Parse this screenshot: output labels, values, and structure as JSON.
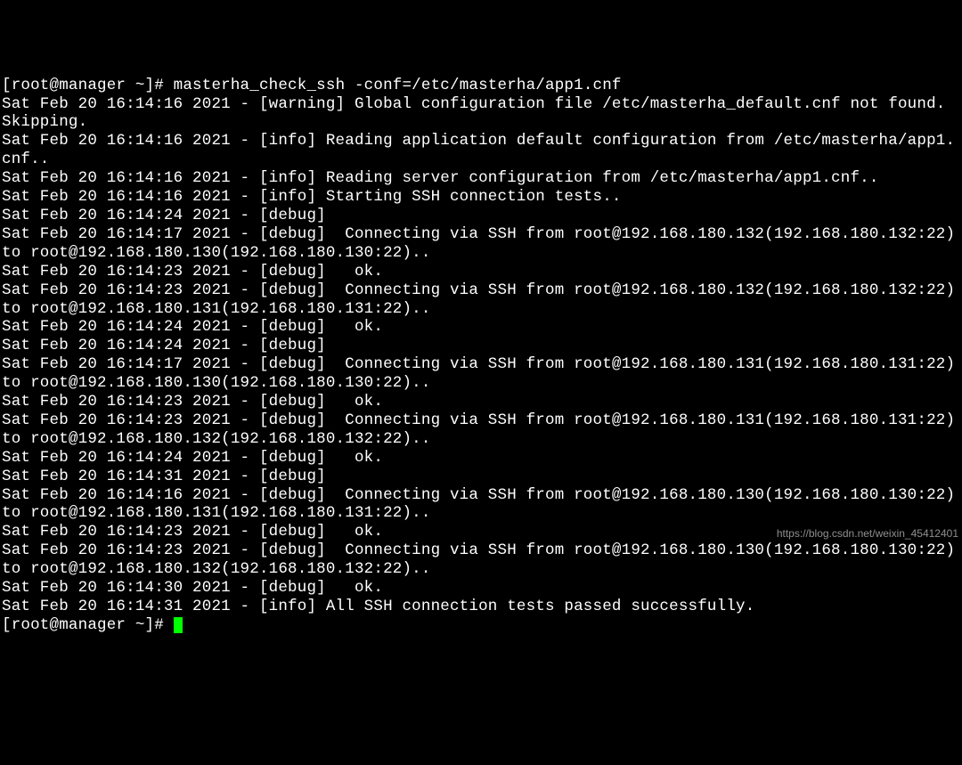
{
  "terminal": {
    "prompt": "[root@manager ~]# ",
    "command": "masterha_check_ssh -conf=/etc/masterha/app1.cnf",
    "lines": [
      "Sat Feb 20 16:14:16 2021 - [warning] Global configuration file /etc/masterha_default.cnf not found. Skipping.",
      "Sat Feb 20 16:14:16 2021 - [info] Reading application default configuration from /etc/masterha/app1.cnf..",
      "Sat Feb 20 16:14:16 2021 - [info] Reading server configuration from /etc/masterha/app1.cnf..",
      "Sat Feb 20 16:14:16 2021 - [info] Starting SSH connection tests..",
      "Sat Feb 20 16:14:24 2021 - [debug] ",
      "Sat Feb 20 16:14:17 2021 - [debug]  Connecting via SSH from root@192.168.180.132(192.168.180.132:22) to root@192.168.180.130(192.168.180.130:22)..",
      "Sat Feb 20 16:14:23 2021 - [debug]   ok.",
      "Sat Feb 20 16:14:23 2021 - [debug]  Connecting via SSH from root@192.168.180.132(192.168.180.132:22) to root@192.168.180.131(192.168.180.131:22)..",
      "Sat Feb 20 16:14:24 2021 - [debug]   ok.",
      "Sat Feb 20 16:14:24 2021 - [debug] ",
      "Sat Feb 20 16:14:17 2021 - [debug]  Connecting via SSH from root@192.168.180.131(192.168.180.131:22) to root@192.168.180.130(192.168.180.130:22)..",
      "Sat Feb 20 16:14:23 2021 - [debug]   ok.",
      "Sat Feb 20 16:14:23 2021 - [debug]  Connecting via SSH from root@192.168.180.131(192.168.180.131:22) to root@192.168.180.132(192.168.180.132:22)..",
      "Sat Feb 20 16:14:24 2021 - [debug]   ok.",
      "Sat Feb 20 16:14:31 2021 - [debug] ",
      "Sat Feb 20 16:14:16 2021 - [debug]  Connecting via SSH from root@192.168.180.130(192.168.180.130:22) to root@192.168.180.131(192.168.180.131:22)..",
      "Sat Feb 20 16:14:23 2021 - [debug]   ok.",
      "Sat Feb 20 16:14:23 2021 - [debug]  Connecting via SSH from root@192.168.180.130(192.168.180.130:22) to root@192.168.180.132(192.168.180.132:22)..",
      "Sat Feb 20 16:14:30 2021 - [debug]   ok.",
      "Sat Feb 20 16:14:31 2021 - [info] All SSH connection tests passed successfully."
    ],
    "prompt2_prefix": "[root@manager ~]# "
  },
  "watermark": "https://blog.csdn.net/weixin_45412401"
}
